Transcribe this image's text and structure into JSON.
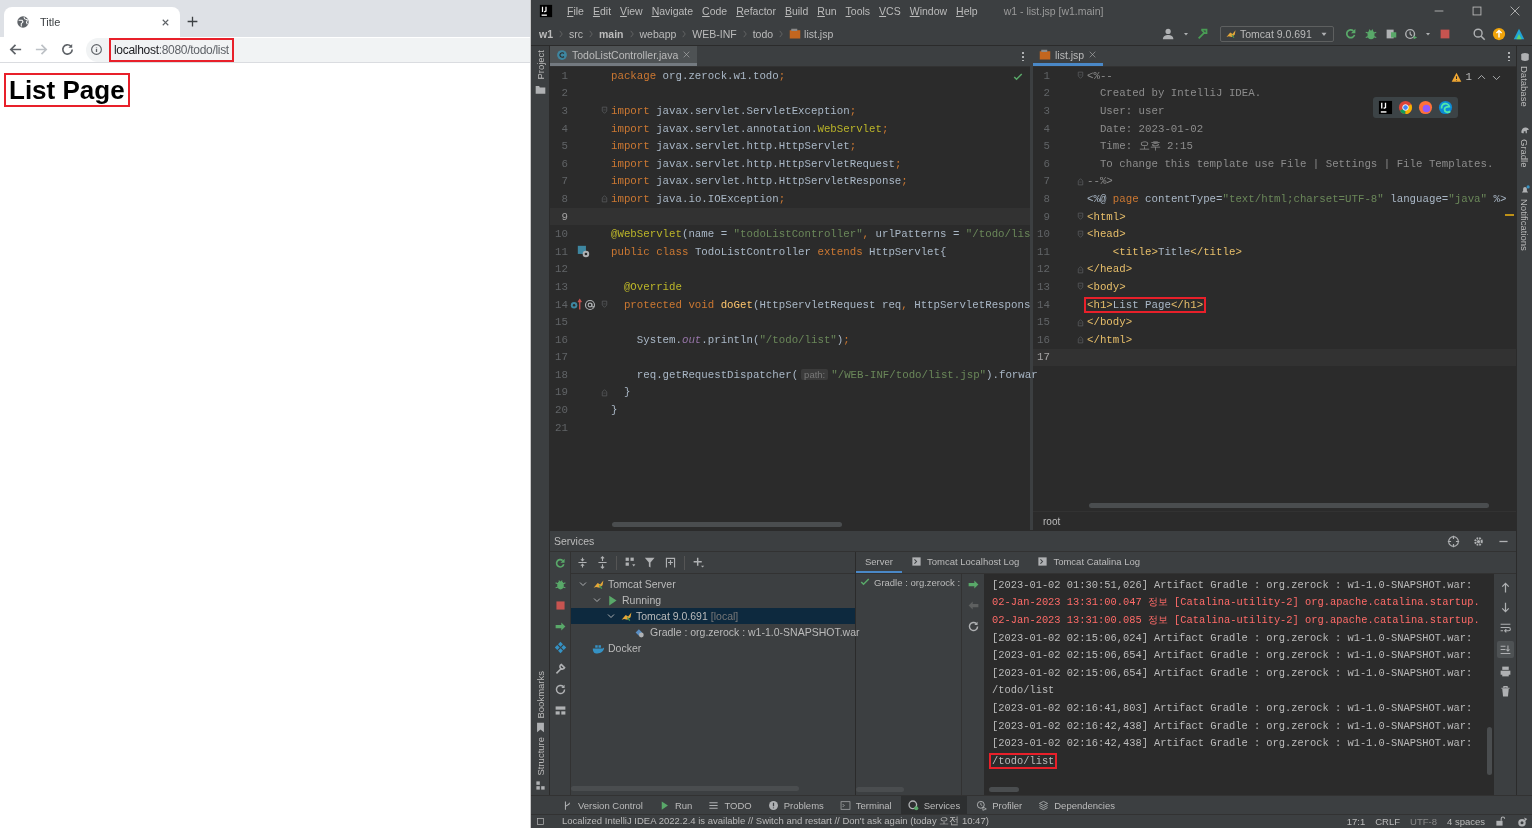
{
  "browser": {
    "tabs": [
      {
        "title": "Title",
        "selected": true
      }
    ],
    "back": {
      "disabled": false
    },
    "forward": {
      "disabled": true
    },
    "url": {
      "host": "localhost",
      "rest": ":8080/todo/list",
      "highlighted": true
    },
    "page": {
      "heading": "List Page",
      "highlighted": true
    }
  },
  "ide": {
    "menu": [
      "File",
      "Edit",
      "View",
      "Navigate",
      "Code",
      "Refactor",
      "Build",
      "Run",
      "Tools",
      "VCS",
      "Window",
      "Help"
    ],
    "title": "w1 - list.jsp [w1.main]",
    "breadcrumb": [
      {
        "label": "w1",
        "bold": true
      },
      {
        "label": "src",
        "bold": false
      },
      {
        "label": "main",
        "bold": true
      },
      {
        "label": "webapp",
        "bold": false
      },
      {
        "label": "WEB-INF",
        "bold": false
      },
      {
        "label": "todo",
        "bold": false
      },
      {
        "label": "list.jsp",
        "bold": false
      }
    ],
    "run_config": "Tomcat 9.0.691",
    "left_stripe": {
      "top": [
        "Project"
      ],
      "bottom": [
        "Bookmarks",
        "Structure"
      ]
    },
    "right_stripe": [
      "Database",
      "Gradle",
      "Notifications"
    ],
    "editors": [
      {
        "active": false,
        "tabs": [
          {
            "label": "TodoListController.java",
            "kind": "java",
            "selected": true
          }
        ],
        "status_ok": true,
        "lines": [
          {
            "number": "1",
            "kind": "code",
            "current": false,
            "highlighted": false,
            "fold_open": false,
            "fold_close": false,
            "tokens": [
              {
                "kind": "kw",
                "text": "package "
              },
              {
                "kind": "plain",
                "text": "org.zerock.w1.todo"
              },
              {
                "kind": "kw",
                "text": ";"
              }
            ]
          },
          {
            "number": "2",
            "kind": "code",
            "current": false,
            "highlighted": false,
            "fold_open": false,
            "fold_close": false
          },
          {
            "number": "3",
            "kind": "code",
            "current": false,
            "highlighted": false,
            "fold_open": true,
            "fold_close": false,
            "tokens": [
              {
                "kind": "kw",
                "text": "import "
              },
              {
                "kind": "plain",
                "text": "javax.servlet.ServletException"
              },
              {
                "kind": "kw",
                "text": ";"
              }
            ]
          },
          {
            "number": "4",
            "kind": "code",
            "current": false,
            "highlighted": false,
            "fold_open": false,
            "fold_close": false,
            "tokens": [
              {
                "kind": "kw",
                "text": "import "
              },
              {
                "kind": "plain",
                "text": "javax.servlet.annotation."
              },
              {
                "kind": "ann",
                "text": "WebServlet"
              },
              {
                "kind": "kw",
                "text": ";"
              }
            ]
          },
          {
            "number": "5",
            "kind": "code",
            "current": false,
            "highlighted": false,
            "fold_open": false,
            "fold_close": false,
            "tokens": [
              {
                "kind": "kw",
                "text": "import "
              },
              {
                "kind": "plain",
                "text": "javax.servlet.http.HttpServlet"
              },
              {
                "kind": "kw",
                "text": ";"
              }
            ]
          },
          {
            "number": "6",
            "kind": "code",
            "current": false,
            "highlighted": false,
            "fold_open": false,
            "fold_close": false,
            "tokens": [
              {
                "kind": "kw",
                "text": "import "
              },
              {
                "kind": "plain",
                "text": "javax.servlet.http.HttpServletRequest"
              },
              {
                "kind": "kw",
                "text": ";"
              }
            ]
          },
          {
            "number": "7",
            "kind": "code",
            "current": false,
            "highlighted": false,
            "fold_open": false,
            "fold_close": false,
            "tokens": [
              {
                "kind": "kw",
                "text": "import "
              },
              {
                "kind": "plain",
                "text": "javax.servlet.http.HttpServletResponse"
              },
              {
                "kind": "kw",
                "text": ";"
              }
            ]
          },
          {
            "number": "8",
            "kind": "code",
            "current": false,
            "highlighted": false,
            "fold_open": false,
            "fold_close": true,
            "tokens": [
              {
                "kind": "kw",
                "text": "import "
              },
              {
                "kind": "plain",
                "text": "java.io.IOException"
              },
              {
                "kind": "kw",
                "text": ";"
              }
            ]
          },
          {
            "number": "9",
            "kind": "code",
            "current": true,
            "highlighted": false,
            "fold_open": false,
            "fold_close": false
          },
          {
            "number": "10",
            "kind": "code",
            "current": false,
            "highlighted": false,
            "fold_open": false,
            "fold_close": false,
            "tokens": [
              {
                "kind": "ann",
                "text": "@WebServlet"
              },
              {
                "kind": "plain",
                "text": "(name = "
              },
              {
                "kind": "str",
                "text": "\"todoListController\""
              },
              {
                "kind": "kw",
                "text": ", "
              },
              {
                "kind": "plain",
                "text": "urlPatterns = "
              },
              {
                "kind": "str",
                "text": "\"/todo/lis"
              }
            ]
          },
          {
            "number": "11",
            "kind": "class_declaration",
            "current": false,
            "highlighted": false,
            "fold_open": false,
            "fold_close": false,
            "tokens": [
              {
                "kind": "kw",
                "text": "public class "
              },
              {
                "kind": "plain",
                "text": "TodoListController "
              },
              {
                "kind": "kw",
                "text": "extends "
              },
              {
                "kind": "plain",
                "text": "HttpServlet{"
              }
            ]
          },
          {
            "number": "12",
            "kind": "code",
            "current": false,
            "highlighted": false,
            "fold_open": false,
            "fold_close": false
          },
          {
            "number": "13",
            "kind": "code",
            "current": false,
            "highlighted": false,
            "fold_open": false,
            "fold_close": false,
            "tokens": [
              {
                "kind": "ann",
                "text": "  @Override"
              }
            ]
          },
          {
            "number": "14",
            "kind": "method_override",
            "current": false,
            "highlighted": false,
            "fold_open": true,
            "fold_close": false,
            "tokens": [
              {
                "kind": "kw",
                "text": "  protected void "
              },
              {
                "kind": "method",
                "text": "doGet"
              },
              {
                "kind": "plain",
                "text": "(HttpServletRequest req"
              },
              {
                "kind": "kw",
                "text": ", "
              },
              {
                "kind": "plain",
                "text": "HttpServletRespons"
              }
            ]
          },
          {
            "number": "15",
            "kind": "code",
            "current": false,
            "highlighted": false,
            "fold_open": false,
            "fold_close": false
          },
          {
            "number": "16",
            "kind": "code",
            "current": false,
            "highlighted": false,
            "fold_open": false,
            "fold_close": false,
            "tokens": [
              {
                "kind": "plain",
                "text": "    System."
              },
              {
                "kind": "field",
                "text": "out"
              },
              {
                "kind": "plain",
                "text": ".println("
              },
              {
                "kind": "str",
                "text": "\"/todo/list\""
              },
              {
                "kind": "plain",
                "text": ")"
              },
              {
                "kind": "kw",
                "text": ";"
              }
            ]
          },
          {
            "number": "17",
            "kind": "code",
            "current": false,
            "highlighted": false,
            "fold_open": false,
            "fold_close": false
          },
          {
            "number": "18",
            "kind": "code",
            "current": false,
            "highlighted": false,
            "fold_open": false,
            "fold_close": false,
            "tokens": [
              {
                "kind": "plain",
                "text": "    req.getRequestDispatcher("
              },
              {
                "kind": "hint",
                "text": "path:"
              },
              {
                "kind": "str",
                "text": "\"/WEB-INF/todo/list.jsp\""
              },
              {
                "kind": "plain",
                "text": ").forwar"
              }
            ]
          },
          {
            "number": "19",
            "kind": "code",
            "current": false,
            "highlighted": false,
            "fold_open": false,
            "fold_close": true,
            "tokens": [
              {
                "kind": "plain",
                "text": "  }"
              }
            ]
          },
          {
            "number": "20",
            "kind": "code",
            "current": false,
            "highlighted": false,
            "fold_open": false,
            "fold_close": false,
            "tokens": [
              {
                "kind": "plain",
                "text": "}"
              }
            ]
          },
          {
            "number": "21",
            "kind": "code",
            "current": false,
            "highlighted": false,
            "fold_open": false,
            "fold_close": false
          }
        ]
      },
      {
        "active": true,
        "tabs": [
          {
            "label": "list.jsp",
            "kind": "jsp",
            "selected": true
          }
        ],
        "warnings": "1",
        "breadcrumb": "root",
        "lines": [
          {
            "number": "1",
            "kind": "code",
            "current": false,
            "highlighted": false,
            "fold_open": true,
            "fold_close": false,
            "tokens": [
              {
                "kind": "comment",
                "text": "<%--"
              }
            ]
          },
          {
            "number": "2",
            "kind": "code",
            "current": false,
            "highlighted": false,
            "fold_open": false,
            "fold_close": false,
            "tokens": [
              {
                "kind": "comment",
                "text": "  Created by IntelliJ IDEA."
              }
            ]
          },
          {
            "number": "3",
            "kind": "code",
            "current": false,
            "highlighted": false,
            "fold_open": false,
            "fold_close": false,
            "tokens": [
              {
                "kind": "comment",
                "text": "  User: user"
              }
            ]
          },
          {
            "number": "4",
            "kind": "code",
            "current": false,
            "highlighted": false,
            "fold_open": false,
            "fold_close": false,
            "tokens": [
              {
                "kind": "comment",
                "text": "  Date: 2023-01-02"
              }
            ]
          },
          {
            "number": "5",
            "kind": "code",
            "current": false,
            "highlighted": false,
            "fold_open": false,
            "fold_close": false,
            "tokens": [
              {
                "kind": "comment",
                "text": "  Time: 오후 2:15"
              }
            ]
          },
          {
            "number": "6",
            "kind": "code",
            "current": false,
            "highlighted": false,
            "fold_open": false,
            "fold_close": false,
            "tokens": [
              {
                "kind": "comment",
                "text": "  To change this template use File | Settings | File Templates."
              }
            ]
          },
          {
            "number": "7",
            "kind": "code",
            "current": false,
            "highlighted": false,
            "fold_open": false,
            "fold_close": true,
            "tokens": [
              {
                "kind": "comment",
                "text": "--%>"
              }
            ]
          },
          {
            "number": "8",
            "kind": "code",
            "current": false,
            "highlighted": false,
            "fold_open": false,
            "fold_close": false,
            "tokens": [
              {
                "kind": "plain",
                "text": "<%@ "
              },
              {
                "kind": "kw",
                "text": "page "
              },
              {
                "kind": "plain",
                "text": "contentType="
              },
              {
                "kind": "str",
                "text": "\"text/html;charset=UTF-8\""
              },
              {
                "kind": "plain",
                "text": " language="
              },
              {
                "kind": "str",
                "text": "\"java\""
              },
              {
                "kind": "plain",
                "text": " %>"
              }
            ]
          },
          {
            "number": "9",
            "kind": "code",
            "current": false,
            "highlighted": false,
            "fold_open": true,
            "fold_close": false,
            "tokens": [
              {
                "kind": "tag",
                "text": "<html>"
              }
            ]
          },
          {
            "number": "10",
            "kind": "code",
            "current": false,
            "highlighted": false,
            "fold_open": true,
            "fold_close": false,
            "tokens": [
              {
                "kind": "tag",
                "text": "<head>"
              }
            ]
          },
          {
            "number": "11",
            "kind": "code",
            "current": false,
            "highlighted": false,
            "fold_open": false,
            "fold_close": false,
            "tokens": [
              {
                "kind": "tag",
                "text": "    <title>"
              },
              {
                "kind": "plain",
                "text": "Title"
              },
              {
                "kind": "tag",
                "text": "</title>"
              }
            ]
          },
          {
            "number": "12",
            "kind": "code",
            "current": false,
            "highlighted": false,
            "fold_open": false,
            "fold_close": true,
            "tokens": [
              {
                "kind": "tag",
                "text": "</head>"
              }
            ]
          },
          {
            "number": "13",
            "kind": "code",
            "current": false,
            "highlighted": false,
            "fold_open": true,
            "fold_close": false,
            "tokens": [
              {
                "kind": "tag",
                "text": "<body>"
              }
            ]
          },
          {
            "number": "14",
            "kind": "code",
            "current": false,
            "highlighted": true,
            "fold_open": false,
            "fold_close": false,
            "tokens": [
              {
                "kind": "tag",
                "text": "<h1>"
              },
              {
                "kind": "plain",
                "text": "List Page"
              },
              {
                "kind": "tag",
                "text": "</h1>"
              }
            ]
          },
          {
            "number": "15",
            "kind": "code",
            "current": false,
            "highlighted": false,
            "fold_open": false,
            "fold_close": true,
            "tokens": [
              {
                "kind": "tag",
                "text": "</body>"
              }
            ]
          },
          {
            "number": "16",
            "kind": "code",
            "current": false,
            "highlighted": false,
            "fold_open": false,
            "fold_close": true,
            "tokens": [
              {
                "kind": "tag",
                "text": "</html>"
              }
            ]
          },
          {
            "number": "17",
            "kind": "code",
            "current": true,
            "highlighted": false,
            "fold_open": false,
            "fold_close": false
          }
        ]
      }
    ],
    "services": {
      "title": "Services",
      "tree": [
        {
          "label": "Tomcat Server",
          "kind": "server",
          "expanded": true,
          "selected": false,
          "children": [
            {
              "label": "Running",
              "kind": "status",
              "expanded": true,
              "selected": false,
              "children": [
                {
                  "label": "Tomcat 9.0.691",
                  "suffix": "[local]",
                  "kind": "instance",
                  "expanded": true,
                  "selected": true,
                  "children": [
                    {
                      "label": "Gradle : org.zerock : w1-1.0-SNAPSHOT.war",
                      "kind": "artifact",
                      "selected": false
                    }
                  ]
                }
              ]
            }
          ]
        },
        {
          "label": "Docker",
          "kind": "docker",
          "selected": false
        }
      ],
      "tabs": [
        {
          "label": "Server",
          "kind": "plain",
          "selected": true
        },
        {
          "label": "Tomcat Localhost Log",
          "kind": "log",
          "selected": false
        },
        {
          "label": "Tomcat Catalina Log",
          "kind": "log",
          "selected": false
        }
      ],
      "deployments": [
        {
          "label": "Gradle : org.zerock :",
          "deployed": true
        }
      ],
      "log": [
        {
          "kind": "info",
          "highlighted": false,
          "text": "[2023-01-02 01:30:51,026] Artifact Gradle : org.zerock : w1-1.0-SNAPSHOT.war:"
        },
        {
          "kind": "error",
          "highlighted": false,
          "text": "02-Jan-2023 13:31:00.047 정보 [Catalina-utility-2] org.apache.catalina.startup."
        },
        {
          "kind": "error",
          "highlighted": false,
          "text": "02-Jan-2023 13:31:00.085 정보 [Catalina-utility-2] org.apache.catalina.startup."
        },
        {
          "kind": "info",
          "highlighted": false,
          "text": "[2023-01-02 02:15:06,024] Artifact Gradle : org.zerock : w1-1.0-SNAPSHOT.war:"
        },
        {
          "kind": "info",
          "highlighted": false,
          "text": "[2023-01-02 02:15:06,654] Artifact Gradle : org.zerock : w1-1.0-SNAPSHOT.war:"
        },
        {
          "kind": "info",
          "highlighted": false,
          "text": "[2023-01-02 02:15:06,654] Artifact Gradle : org.zerock : w1-1.0-SNAPSHOT.war:"
        },
        {
          "kind": "info",
          "highlighted": false,
          "text": "/todo/list"
        },
        {
          "kind": "info",
          "highlighted": false,
          "text": "[2023-01-02 02:16:41,803] Artifact Gradle : org.zerock : w1-1.0-SNAPSHOT.war:"
        },
        {
          "kind": "info",
          "highlighted": false,
          "text": "[2023-01-02 02:16:42,438] Artifact Gradle : org.zerock : w1-1.0-SNAPSHOT.war:"
        },
        {
          "kind": "info",
          "highlighted": false,
          "text": "[2023-01-02 02:16:42,438] Artifact Gradle : org.zerock : w1-1.0-SNAPSHOT.war:"
        },
        {
          "kind": "info",
          "highlighted": true,
          "text": "/todo/list"
        }
      ]
    },
    "tool_tabs": [
      {
        "label": "Version Control",
        "selected": false
      },
      {
        "label": "Run",
        "selected": false
      },
      {
        "label": "TODO",
        "selected": false
      },
      {
        "label": "Problems",
        "selected": false
      },
      {
        "label": "Terminal",
        "selected": false
      },
      {
        "label": "Services",
        "selected": true
      },
      {
        "label": "Profiler",
        "selected": false
      },
      {
        "label": "Dependencies",
        "selected": false
      }
    ],
    "status": {
      "message": "Localized IntelliJ IDEA 2022.2.4 is available // Switch and restart // Don't ask again (today 오전 10:47)",
      "position": "17:1",
      "line_separator": "CRLF",
      "encoding": {
        "label": "UTF-8",
        "disabled": true
      },
      "indent": "4 spaces"
    }
  }
}
